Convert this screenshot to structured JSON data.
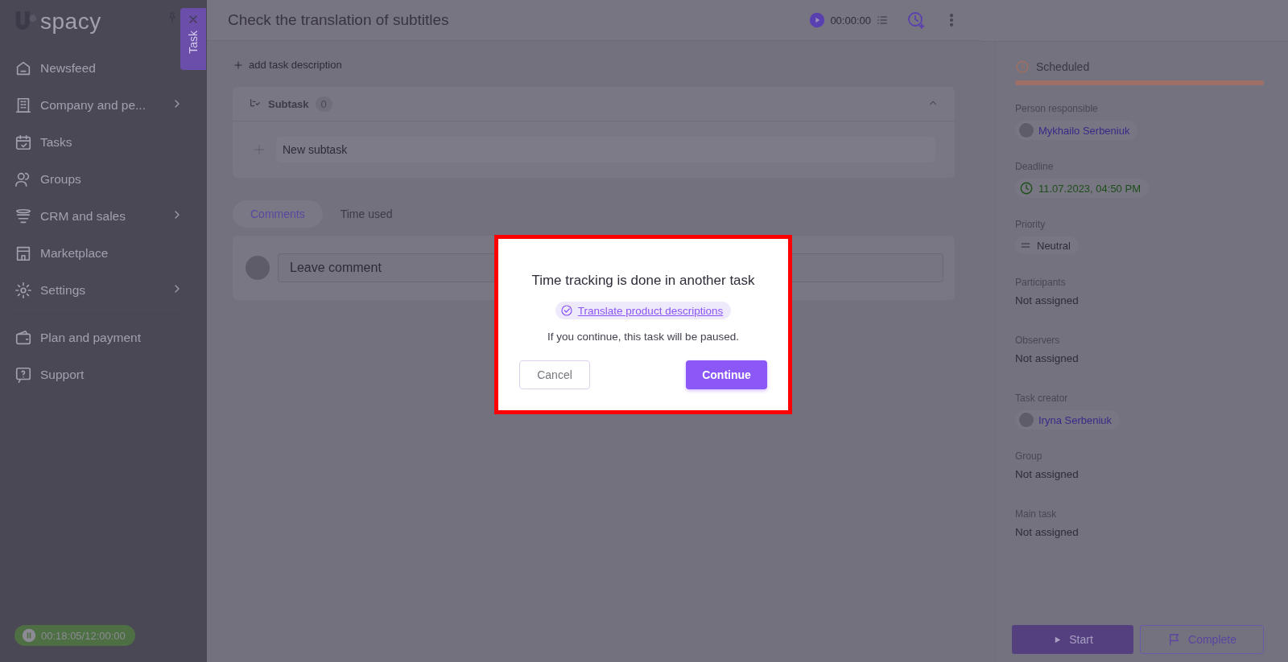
{
  "sidebar": {
    "logo": "spacy",
    "items": [
      {
        "label": "Newsfeed",
        "has_submenu": false
      },
      {
        "label": "Company and pe...",
        "has_submenu": true
      },
      {
        "label": "Tasks",
        "has_submenu": false
      },
      {
        "label": "Groups",
        "has_submenu": false
      },
      {
        "label": "CRM and sales",
        "has_submenu": true
      },
      {
        "label": "Marketplace",
        "has_submenu": false
      },
      {
        "label": "Settings",
        "has_submenu": true
      },
      {
        "label": "Plan and payment",
        "has_submenu": false
      },
      {
        "label": "Support",
        "has_submenu": false
      }
    ],
    "timer": "00:18:05/12:00:00"
  },
  "side_tab": {
    "label": "Task"
  },
  "task": {
    "title": "Check the translation of subtitles",
    "timer": "00:00:00",
    "add_description": "add task description",
    "subtask": {
      "label": "Subtask",
      "count": "0",
      "expanded": true,
      "placeholder": "New subtask"
    },
    "tabs": [
      {
        "label": "Comments",
        "selected": true
      },
      {
        "label": "Time used",
        "selected": false
      }
    ],
    "comment": {
      "placeholder": "Leave comment"
    }
  },
  "details": {
    "status": "Scheduled",
    "fields": [
      {
        "label": "Person responsible",
        "kind": "person",
        "value": "Mykhailo Serbeniuk"
      },
      {
        "label": "Deadline",
        "kind": "date",
        "value": "11.07.2023, 04:50 PM"
      },
      {
        "label": "Priority",
        "kind": "priority",
        "value": "Neutral"
      },
      {
        "label": "Participants",
        "kind": "empty",
        "value": "Not assigned"
      },
      {
        "label": "Observers",
        "kind": "empty",
        "value": "Not assigned"
      },
      {
        "label": "Task creator",
        "kind": "person",
        "value": "Iryna Serbeniuk"
      },
      {
        "label": "Group",
        "kind": "empty",
        "value": "Not assigned"
      },
      {
        "label": "Main task",
        "kind": "empty",
        "value": "Not assigned"
      }
    ],
    "start": "Start",
    "complete": "Complete"
  },
  "dialog": {
    "title": "Time tracking is done in another task",
    "task_link": "Translate product descriptions",
    "message": "If you continue, this task will be paused.",
    "cancel": "Cancel",
    "confirm": "Continue"
  }
}
